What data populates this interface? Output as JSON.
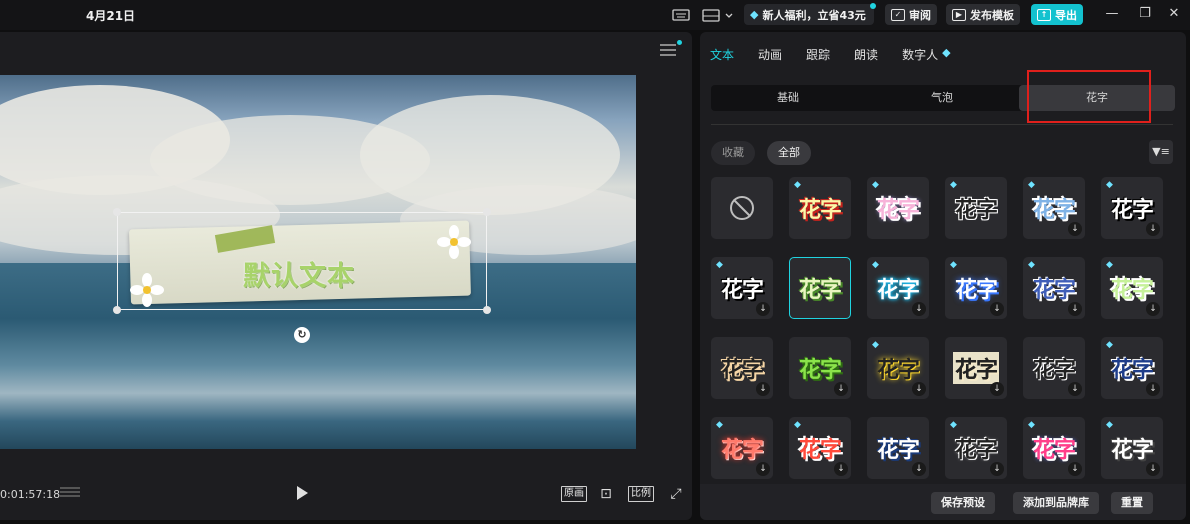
{
  "topbar": {
    "date": "4月21日",
    "promo_text": "新人福利，立省43元",
    "review_label": "审阅",
    "publish_label": "发布模板",
    "export_label": "导出"
  },
  "player": {
    "default_text": "默认文本",
    "timecode": "0:01:57:18",
    "original_label": "原画",
    "ratio_label": "比例"
  },
  "panel": {
    "tabs": [
      "文本",
      "动画",
      "跟踪",
      "朗读",
      "数字人"
    ],
    "active_tab": "文本",
    "subtabs": [
      "基础",
      "气泡",
      "花字"
    ],
    "active_subtab": "花字",
    "filters": {
      "favorites": "收藏",
      "all": "全部"
    },
    "tile_text": "花字",
    "bottom": {
      "save_preset": "保存预设",
      "add_brand": "添加到品牌库",
      "reset": "重置"
    }
  },
  "colors": {
    "accent": "#20d3e0",
    "highlight_box": "#e0201c"
  }
}
